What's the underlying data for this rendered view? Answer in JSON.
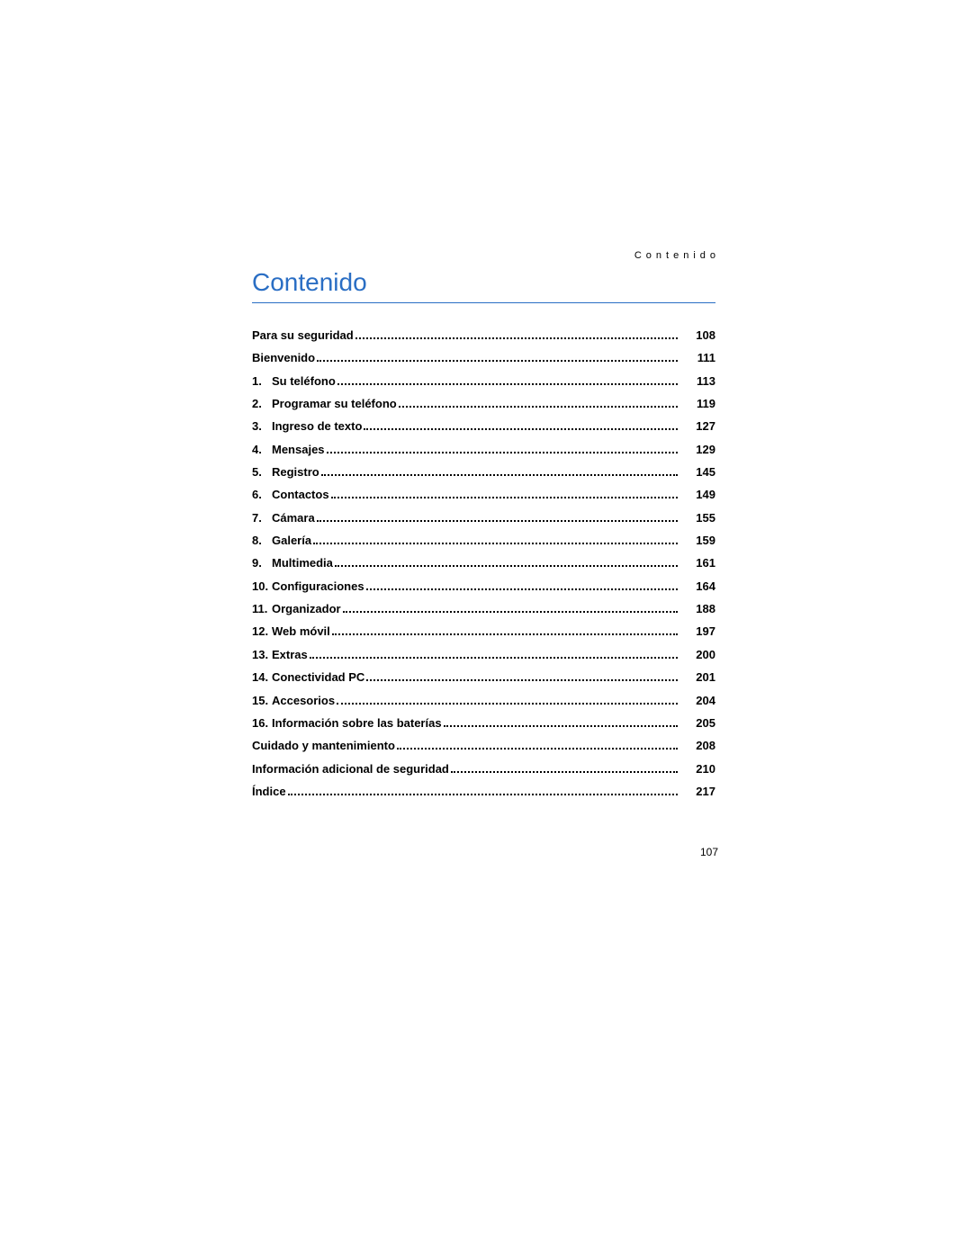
{
  "running_header": "Contenido",
  "title": "Contenido",
  "page_number": "107",
  "toc": [
    {
      "num": "",
      "label": "Para su seguridad",
      "page": "108"
    },
    {
      "num": "",
      "label": "Bienvenido",
      "page": "111"
    },
    {
      "num": "1.",
      "label": "Su teléfono",
      "page": "113"
    },
    {
      "num": "2.",
      "label": "Programar su teléfono",
      "page": "119"
    },
    {
      "num": "3.",
      "label": "Ingreso de texto",
      "page": "127"
    },
    {
      "num": "4.",
      "label": "Mensajes",
      "page": "129"
    },
    {
      "num": "5.",
      "label": "Registro",
      "page": "145"
    },
    {
      "num": "6.",
      "label": "Contactos",
      "page": "149"
    },
    {
      "num": "7.",
      "label": "Cámara",
      "page": "155"
    },
    {
      "num": "8.",
      "label": "Galería",
      "page": "159"
    },
    {
      "num": "9.",
      "label": "Multimedia",
      "page": "161"
    },
    {
      "num": "10.",
      "label": "Configuraciones",
      "page": "164"
    },
    {
      "num": "11.",
      "label": "Organizador",
      "page": "188"
    },
    {
      "num": "12.",
      "label": "Web móvil",
      "page": "197"
    },
    {
      "num": "13.",
      "label": "Extras",
      "page": "200"
    },
    {
      "num": "14.",
      "label": "Conectividad PC",
      "page": "201"
    },
    {
      "num": "15.",
      "label": "Accesorios",
      "page": "204"
    },
    {
      "num": "16.",
      "label": "Información sobre las baterías",
      "page": "205"
    },
    {
      "num": "",
      "label": "Cuidado y mantenimiento",
      "page": "208"
    },
    {
      "num": "",
      "label": "Información adicional de seguridad",
      "page": "210"
    },
    {
      "num": "",
      "label": "Índice",
      "page": "217"
    }
  ]
}
